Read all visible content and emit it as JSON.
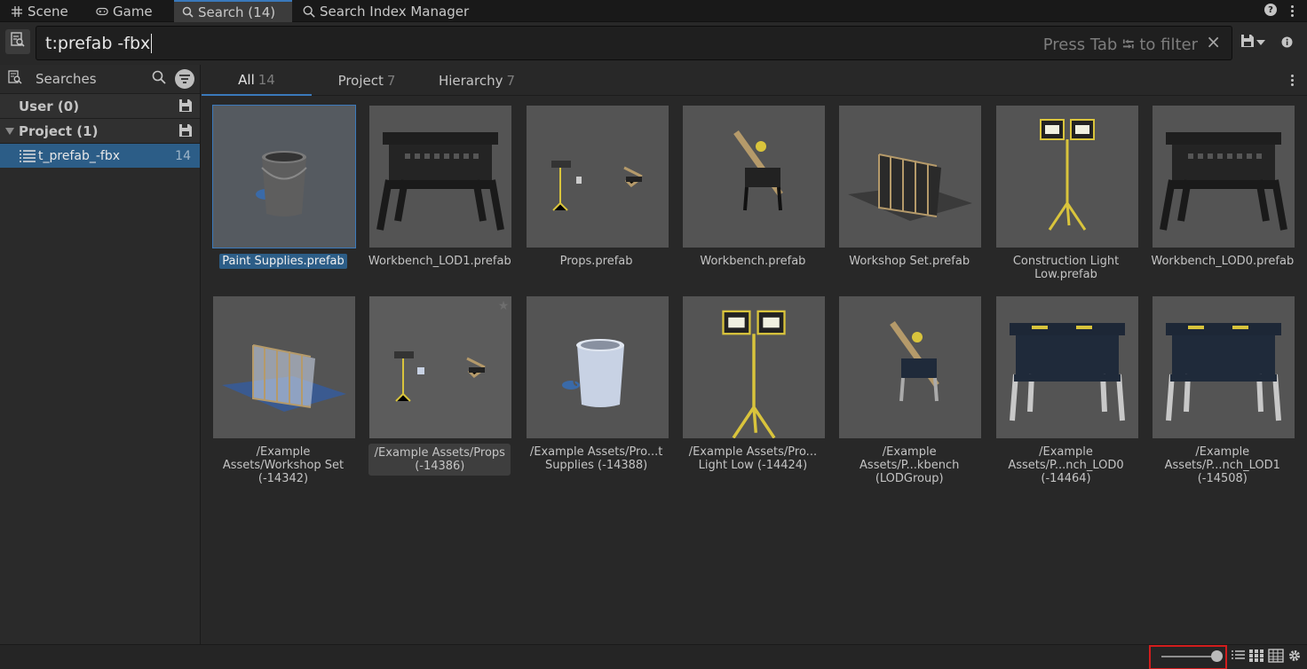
{
  "window_tabs": [
    {
      "label": "Scene",
      "icon": "grid-hash-icon"
    },
    {
      "label": "Game",
      "icon": "gamepad-icon"
    },
    {
      "label": "Search (14)",
      "icon": "search-icon"
    },
    {
      "label": "Search Index Manager",
      "icon": "search-icon"
    }
  ],
  "active_window_tab": "Search (14)",
  "search": {
    "query": "t:prefab -fbx",
    "hint": "Press Tab ⭾ to filter",
    "clear": "×"
  },
  "sidebar": {
    "title": "Searches",
    "groups": [
      {
        "label": "User (0)"
      },
      {
        "label": "Project (1)"
      }
    ],
    "queries": [
      {
        "label": "t_prefab_-fbx",
        "count": "14"
      }
    ]
  },
  "result_tabs": [
    {
      "label": "All",
      "count": "14"
    },
    {
      "label": "Project",
      "count": "7"
    },
    {
      "label": "Hierarchy",
      "count": "7"
    }
  ],
  "items": [
    {
      "label": "Paint Supplies.prefab",
      "thumb": "bucket-gray"
    },
    {
      "label": "Workbench_LOD1.prefab",
      "thumb": "workbench-dark"
    },
    {
      "label": "Props.prefab",
      "thumb": "props-small"
    },
    {
      "label": "Workbench.prefab",
      "thumb": "workbench-side"
    },
    {
      "label": "Workshop Set.prefab",
      "thumb": "workshop-frame"
    },
    {
      "label": "Construction Light Low.prefab",
      "thumb": "light-tripod"
    },
    {
      "label": "Workbench_LOD0.prefab",
      "thumb": "workbench-dark"
    },
    {
      "label": "/Example Assets/Workshop Set (-14342)",
      "thumb": "workshop-frame-blue"
    },
    {
      "label": "/Example Assets/Props (-14386)",
      "thumb": "props-small-blue"
    },
    {
      "label": "/Example Assets/Pro...t Supplies (-14388)",
      "thumb": "bucket-blue"
    },
    {
      "label": "/Example Assets/Pro... Light Low (-14424)",
      "thumb": "light-tripod-big"
    },
    {
      "label": "/Example Assets/P...kbench (LODGroup)",
      "thumb": "workbench-side-blue"
    },
    {
      "label": "/Example Assets/P...nch_LOD0 (-14464)",
      "thumb": "workbench-blue"
    },
    {
      "label": "/Example Assets/P...nch_LOD1 (-14508)",
      "thumb": "workbench-blue"
    }
  ],
  "selected_item_index": 0,
  "hovered_item_index": 8,
  "zoom_level": 1.0,
  "colors": {
    "accent": "#3a79bb",
    "selection": "#2c5d87",
    "highlight_box": "#d21d1d"
  }
}
